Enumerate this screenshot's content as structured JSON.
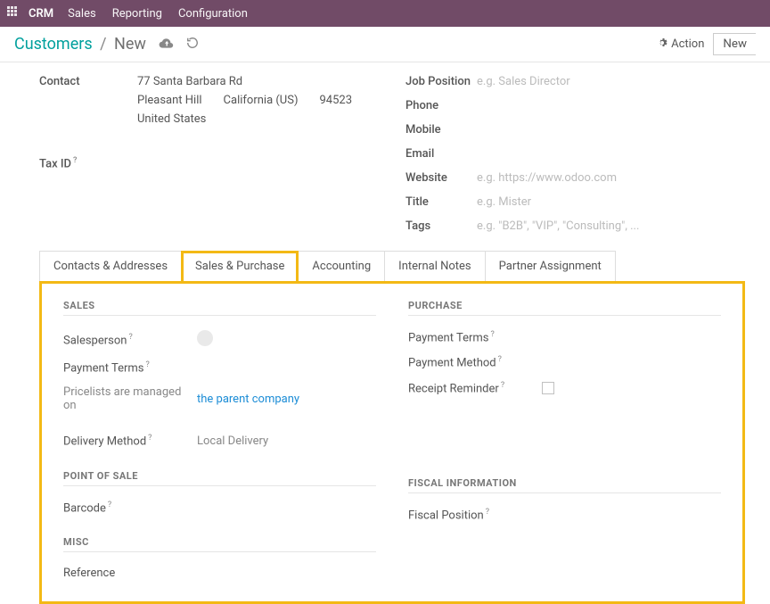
{
  "topbar": {
    "brand": "CRM",
    "menu": [
      "Sales",
      "Reporting",
      "Configuration"
    ]
  },
  "breadcrumb": {
    "root": "Customers",
    "current": "New",
    "action_label": "Action",
    "new_label": "New"
  },
  "header": {
    "contact_label": "Contact",
    "address": {
      "street": "77 Santa Barbara Rd",
      "city": "Pleasant Hill",
      "state_country": "California (US)",
      "zip": "94523",
      "country": "United States"
    },
    "taxid_label": "Tax ID",
    "right_fields": [
      {
        "label": "Job Position",
        "placeholder": "e.g. Sales Director"
      },
      {
        "label": "Phone",
        "placeholder": ""
      },
      {
        "label": "Mobile",
        "placeholder": ""
      },
      {
        "label": "Email",
        "placeholder": ""
      },
      {
        "label": "Website",
        "placeholder": "e.g. https://www.odoo.com"
      },
      {
        "label": "Title",
        "placeholder": "e.g. Mister"
      },
      {
        "label": "Tags",
        "placeholder": "e.g. \"B2B\", \"VIP\", \"Consulting\", ..."
      }
    ]
  },
  "tabs": {
    "items": [
      "Contacts & Addresses",
      "Sales & Purchase",
      "Accounting",
      "Internal Notes",
      "Partner Assignment"
    ],
    "active_index": 1
  },
  "sales_purchase": {
    "left": {
      "sales_title": "SALES",
      "salesperson_label": "Salesperson",
      "payment_terms_label": "Payment Terms",
      "pricelist_text": "Pricelists are managed on",
      "pricelist_link": "the parent company",
      "delivery_method_label": "Delivery Method",
      "delivery_method_value": "Local Delivery",
      "pos_title": "POINT OF SALE",
      "barcode_label": "Barcode",
      "misc_title": "MISC",
      "reference_label": "Reference"
    },
    "right": {
      "purchase_title": "PURCHASE",
      "payment_terms_label": "Payment Terms",
      "payment_method_label": "Payment Method",
      "receipt_reminder_label": "Receipt Reminder",
      "fiscal_title": "FISCAL INFORMATION",
      "fiscal_position_label": "Fiscal Position"
    }
  }
}
